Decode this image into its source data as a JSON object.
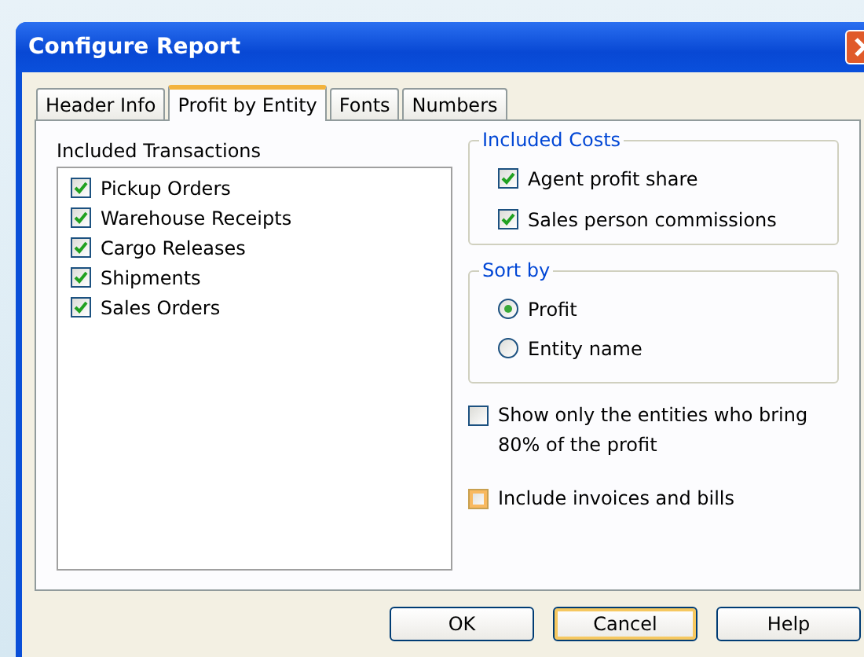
{
  "window": {
    "title": "Configure Report"
  },
  "tabs": [
    {
      "label": "Header Info",
      "selected": false
    },
    {
      "label": "Profit by Entity",
      "selected": true
    },
    {
      "label": "Fonts",
      "selected": false
    },
    {
      "label": "Numbers",
      "selected": false
    }
  ],
  "included_transactions": {
    "label": "Included Transactions",
    "items": [
      {
        "label": "Pickup Orders",
        "checked": true
      },
      {
        "label": "Warehouse Receipts",
        "checked": true
      },
      {
        "label": "Cargo Releases",
        "checked": true
      },
      {
        "label": "Shipments",
        "checked": true
      },
      {
        "label": "Sales Orders",
        "checked": true
      }
    ]
  },
  "included_costs": {
    "label": "Included Costs",
    "items": [
      {
        "label": "Agent profit share",
        "checked": true
      },
      {
        "label": "Sales person commissions",
        "checked": true
      }
    ]
  },
  "sort_by": {
    "label": "Sort by",
    "options": [
      {
        "label": "Profit",
        "selected": true
      },
      {
        "label": "Entity name",
        "selected": false
      }
    ]
  },
  "options": [
    {
      "label": "Show only the entities who bring 80% of the profit",
      "checked": false,
      "focused": false
    },
    {
      "label": "Include invoices and bills",
      "checked": false,
      "focused": true
    }
  ],
  "buttons": [
    {
      "label": "OK",
      "default": false
    },
    {
      "label": "Cancel",
      "default": true
    },
    {
      "label": "Help",
      "default": false
    }
  ]
}
